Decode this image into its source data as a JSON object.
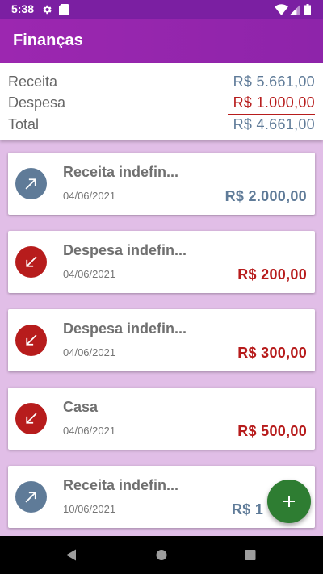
{
  "status_bar": {
    "time": "5:38",
    "icons": [
      "settings-icon",
      "sd-card-icon",
      "wifi-icon",
      "signal-icon",
      "battery-icon"
    ]
  },
  "app_bar": {
    "title": "Finanças"
  },
  "summary": {
    "income_label": "Receita",
    "income_value": "R$  5.661,00",
    "expense_label": "Despesa",
    "expense_value": "R$  1.000,00",
    "total_label": "Total",
    "total_value": "R$  4.661,00"
  },
  "colors": {
    "income": "#5f7b98",
    "expense": "#b71c1c",
    "primary": "#9c27b0",
    "fab": "#2e7d32"
  },
  "transactions": [
    {
      "type": "income",
      "name": "Receita indefin...",
      "date": "04/06/2021",
      "amount": "R$  2.000,00"
    },
    {
      "type": "expense",
      "name": "Despesa indefin...",
      "date": "04/06/2021",
      "amount": "R$  200,00"
    },
    {
      "type": "expense",
      "name": "Despesa indefin...",
      "date": "04/06/2021",
      "amount": "R$  300,00"
    },
    {
      "type": "expense",
      "name": "Casa",
      "date": "04/06/2021",
      "amount": "R$  500,00"
    },
    {
      "type": "income",
      "name": "Receita indefin...",
      "date": "10/06/2021",
      "amount": "R$  1"
    }
  ],
  "fab": {
    "icon": "add-icon"
  },
  "nav_bar": {
    "icons": [
      "back-icon",
      "home-icon",
      "recents-icon"
    ]
  }
}
